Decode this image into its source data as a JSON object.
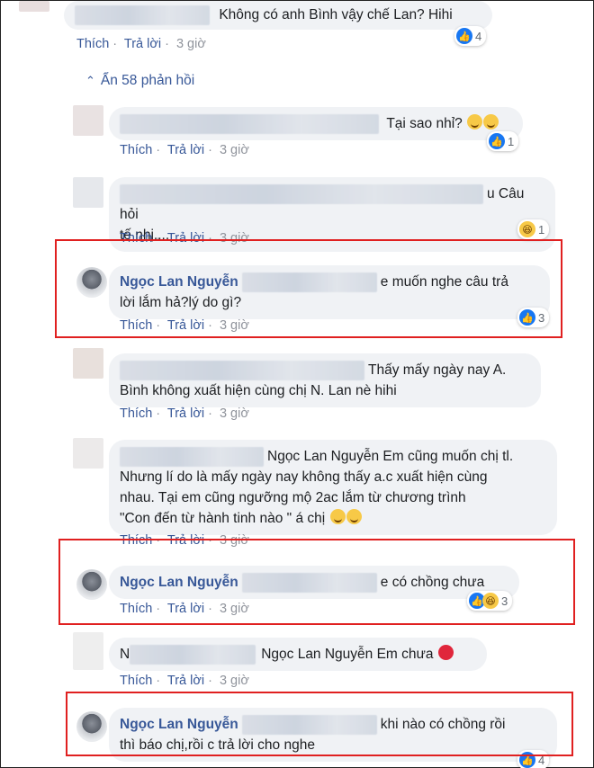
{
  "actions": {
    "like": "Thích",
    "reply": "Trả lời",
    "time": "3 giờ",
    "separator": "·"
  },
  "hide_replies": "Ẩn 58 phản hồi",
  "highlight_color": "#e02020",
  "comments": [
    {
      "name": "",
      "text": "Không có anh Bình vậy chế Lan? Hihi",
      "reaction": "like-icon",
      "count": "4"
    },
    {
      "name": "",
      "text": "Tại sao nhỉ?",
      "reaction": "like-icon",
      "count": "1"
    },
    {
      "name": "",
      "text_a": "u Câu hỏi",
      "text_b": "tế nhị....",
      "reaction": "haha-icon",
      "count": "1"
    },
    {
      "name": "Ngọc Lan Nguyễn",
      "text_a": "e muốn nghe câu trả",
      "text_b": "lời lắm hả?lý do gì?",
      "reaction": "like-icon",
      "count": "3"
    },
    {
      "name": "",
      "text_a": "Thấy mấy ngày nay A.",
      "text_b": "Bình không xuất hiện cùng chị N. Lan nè hihi"
    },
    {
      "name": "",
      "text_a": "Ngọc Lan Nguyễn Em cũng muốn chị tl.",
      "text_b": "Nhưng lí do là mấy ngày nay không thấy a.c xuất hiện cùng",
      "text_c": "nhau. Tại em cũng ngưỡng mộ 2ac lắm từ chương trình",
      "text_d": "\"Con đến từ hành tinh nào \" á chị"
    },
    {
      "name": "Ngọc Lan Nguyễn",
      "text": "e có chồng chưa",
      "reaction": "like-haha-icons",
      "count": "3"
    },
    {
      "name": "N",
      "text": "Ngọc Lan Nguyễn Em chưa"
    },
    {
      "name": "Ngọc Lan Nguyễn",
      "text_a": "khi nào có chồng rồi",
      "text_b": "thì báo chị,rồi c trả lời cho nghe",
      "reaction": "like-icon",
      "count": "4"
    }
  ]
}
